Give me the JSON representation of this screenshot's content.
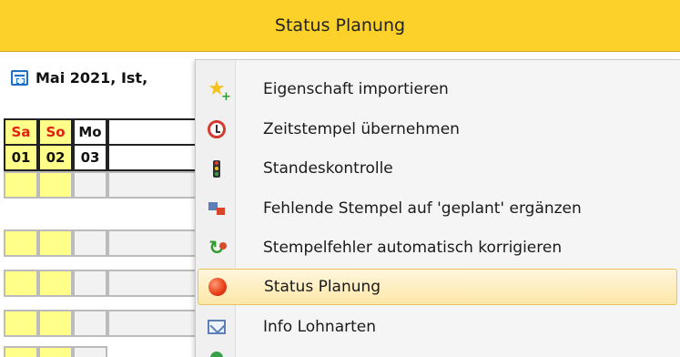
{
  "header": {
    "title": "Status Planung"
  },
  "period": {
    "label": "Mai 2021, Ist,"
  },
  "calendar": {
    "days": [
      {
        "name": "Sa",
        "number": "01",
        "weekend": true
      },
      {
        "name": "So",
        "number": "02",
        "weekend": true
      },
      {
        "name": "Mo",
        "number": "03",
        "weekend": false
      }
    ]
  },
  "context_menu": {
    "items": [
      {
        "label": "Eigenschaft importieren",
        "icon": "star-plus-icon"
      },
      {
        "label": "Zeitstempel übernehmen",
        "icon": "alarm-clock-icon"
      },
      {
        "label": "Standeskontrolle",
        "icon": "traffic-light-icon"
      },
      {
        "label": "Fehlende Stempel auf 'geplant' ergänzen",
        "icon": "stamps-icon"
      },
      {
        "label": "Stempelfehler automatisch korrigieren",
        "icon": "auto-fix-icon"
      },
      {
        "label": "Status Planung",
        "icon": "red-dot-icon",
        "highlighted": true
      },
      {
        "label": "Info Lohnarten",
        "icon": "mail-info-icon"
      }
    ]
  },
  "colors": {
    "header_bg": "#fcd12a",
    "weekend_text": "#e02010",
    "weekend_cell": "#ffff8a",
    "highlight": "#fde7a8"
  }
}
